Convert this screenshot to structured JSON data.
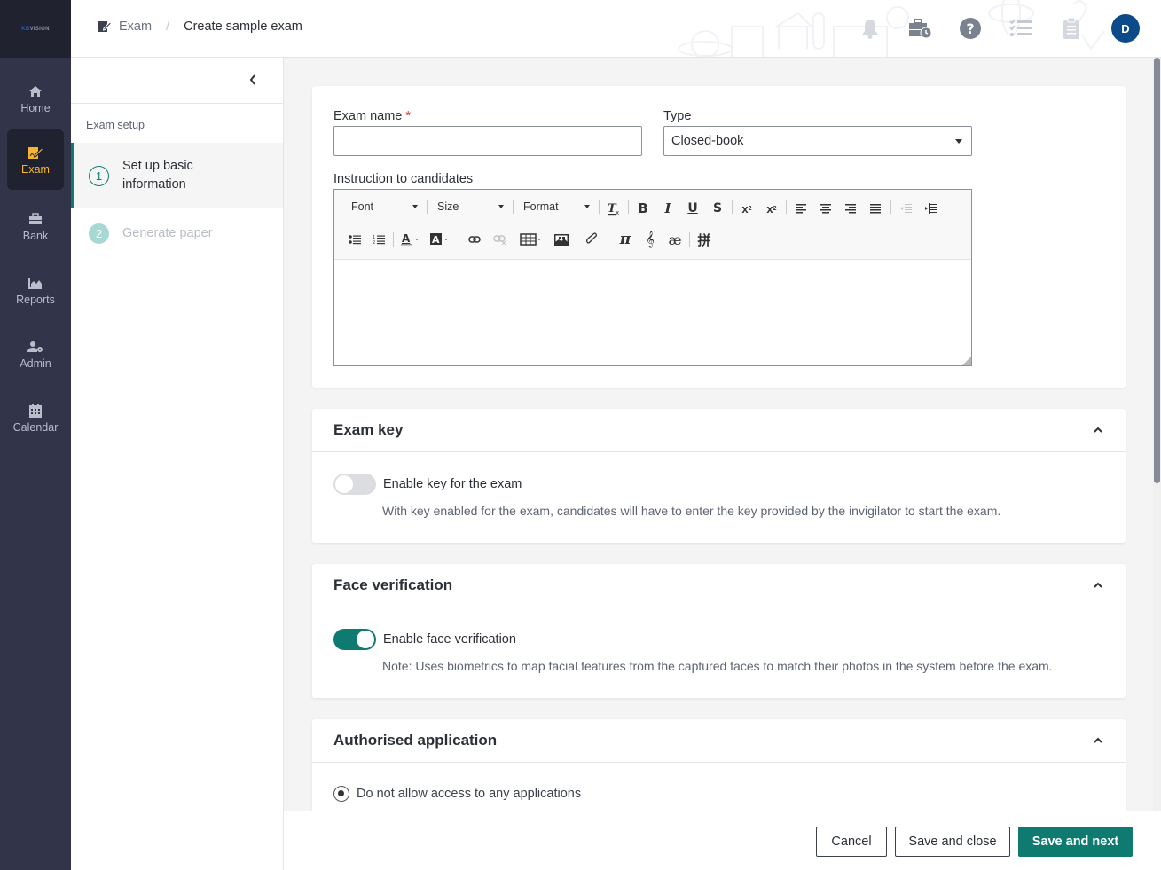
{
  "app": {
    "logo_text_accent": "KB",
    "logo_text": "VISION"
  },
  "nav": {
    "items": [
      {
        "label": "Home",
        "icon": "home-icon",
        "active": false
      },
      {
        "label": "Exam",
        "icon": "exam-icon",
        "active": true
      },
      {
        "label": "Bank",
        "icon": "bank-icon",
        "active": false
      },
      {
        "label": "Reports",
        "icon": "reports-icon",
        "active": false
      },
      {
        "label": "Admin",
        "icon": "admin-icon",
        "active": false
      },
      {
        "label": "Calendar",
        "icon": "calendar-icon",
        "active": false
      }
    ]
  },
  "header": {
    "breadcrumb": {
      "root": "Exam",
      "separator": "/",
      "current": "Create sample exam"
    },
    "icons": [
      "bell-icon",
      "briefcase-clock-icon",
      "help-icon",
      "checklist-icon",
      "clipboard-icon"
    ],
    "avatar_initial": "D"
  },
  "steps": {
    "section_title": "Exam setup",
    "items": [
      {
        "number": "1",
        "label": "Set up basic information",
        "state": "active"
      },
      {
        "number": "2",
        "label": "Generate paper",
        "state": "disabled"
      }
    ]
  },
  "form": {
    "exam_name": {
      "label": "Exam name",
      "required_mark": "*",
      "value": "",
      "placeholder": ""
    },
    "type": {
      "label": "Type",
      "value": "Closed-book"
    },
    "instructions": {
      "label": "Instruction to candidates",
      "toolbar": {
        "font": "Font",
        "size": "Size",
        "format": "Format"
      },
      "value": ""
    }
  },
  "exam_key": {
    "title": "Exam key",
    "toggle_label": "Enable key for the exam",
    "enabled": false,
    "note": "With key enabled for the exam, candidates will have to enter the key provided by the invigilator to start the exam."
  },
  "face_verification": {
    "title": "Face verification",
    "toggle_label": "Enable face verification",
    "enabled": true,
    "note": "Note: Uses biometrics to map facial features from the captured faces to match their photos in the system before the exam."
  },
  "authorised_application": {
    "title": "Authorised application",
    "options": [
      {
        "label": "Do not allow access to any applications",
        "checked": true
      }
    ]
  },
  "footer": {
    "cancel": "Cancel",
    "save_close": "Save and close",
    "save_next": "Save and next"
  },
  "colors": {
    "accent": "#0e7a70",
    "nav_bg": "#32344a",
    "nav_active": "#f2b632",
    "avatar": "#0d4a8a",
    "required": "#e0312d"
  }
}
